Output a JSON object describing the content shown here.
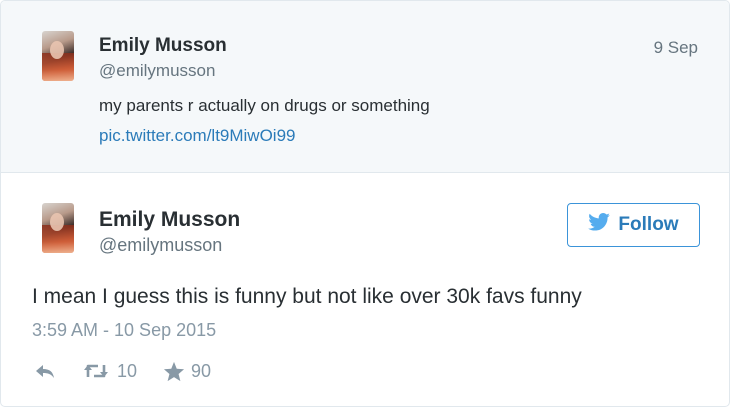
{
  "parent_tweet": {
    "name": "Emily Musson",
    "handle": "@emilymusson",
    "date": "9 Sep",
    "text": "my parents r actually on drugs or something",
    "link": "pic.twitter.com/lt9MiwOi99"
  },
  "main_tweet": {
    "name": "Emily Musson",
    "handle": "@emilymusson",
    "follow_label": "Follow",
    "text": "I mean I guess this is funny but not like over 30k favs funny",
    "timestamp": "3:59 AM - 10 Sep 2015",
    "retweet_count": "10",
    "favorite_count": "90"
  },
  "colors": {
    "accent": "#2b7bb9",
    "muted": "#8899a6",
    "parent_bg": "#f5f8fa"
  },
  "icons": [
    "twitter-bird-icon",
    "reply-icon",
    "retweet-icon",
    "star-icon"
  ]
}
